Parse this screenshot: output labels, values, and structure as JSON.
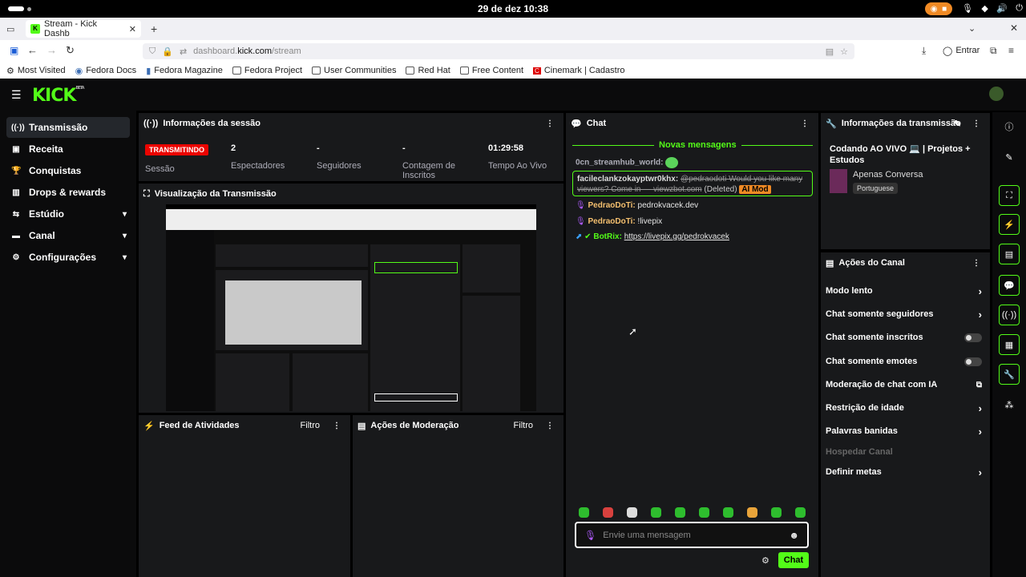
{
  "os": {
    "clock": "29 de dez  10:38"
  },
  "browser": {
    "tab_title": "Stream - Kick Dashb",
    "url_prefix": "dashboard.",
    "url_host": "kick.com",
    "url_path": "/stream",
    "signin": "Entrar",
    "bookmarks": [
      "Most Visited",
      "Fedora Docs",
      "Fedora Magazine",
      "Fedora Project",
      "User Communities",
      "Red Hat",
      "Free Content",
      "Cinemark | Cadastro"
    ]
  },
  "brand": {
    "logo": "KICK",
    "beta": "BETA",
    "accent": "#53fc18"
  },
  "sidebar": {
    "items": [
      {
        "label": "Transmissão",
        "icon": "broadcast-icon"
      },
      {
        "label": "Receita",
        "icon": "revenue-icon"
      },
      {
        "label": "Conquistas",
        "icon": "trophy-icon"
      },
      {
        "label": "Drops & rewards",
        "icon": "drops-icon"
      },
      {
        "label": "Estúdio",
        "icon": "studio-icon"
      },
      {
        "label": "Canal",
        "icon": "channel-icon"
      },
      {
        "label": "Configurações",
        "icon": "gear-icon"
      }
    ]
  },
  "session": {
    "title": "Informações da sessão",
    "status": "TRANSMITINDO",
    "stats": [
      {
        "value": "2",
        "label": "Espectadores"
      },
      {
        "value": "-",
        "label": "Seguidores"
      },
      {
        "value": "-",
        "label": "Contagem de Inscritos"
      },
      {
        "value": "01:29:58",
        "label": "Tempo Ao Vivo"
      }
    ],
    "session_label": "Sessão"
  },
  "preview": {
    "title": "Visualização da Transmissão"
  },
  "feed": {
    "title": "Feed de Atividades",
    "filter": "Filtro"
  },
  "moderation": {
    "title": "Ações de Moderação",
    "filter": "Filtro"
  },
  "chat": {
    "title": "Chat",
    "new_messages": "Novas mensagens",
    "messages": [
      {
        "user": "0cn_streamhub_world:",
        "text": ""
      },
      {
        "user": "facileclankzokayptwr0khx:",
        "text": "@pedraodoti Would you like many viewers? Come in — viewzbot.com",
        "deleted": "(Deleted)",
        "tag": "AI Mod"
      },
      {
        "user": "PedraoDoTi:",
        "text": "pedrokvacek.dev"
      },
      {
        "user": "PedraoDoTi:",
        "text": "!livepix"
      },
      {
        "user": "BotRix:",
        "text": "https://livepix.gg/pedrokvacek"
      }
    ],
    "placeholder": "Envie uma mensagem",
    "send": "Chat"
  },
  "stream_info": {
    "title": "Informações da transmissão",
    "stream_title": "Codando AO VIVO 💻 | Projetos + Estudos",
    "category": "Apenas Conversa",
    "language": "Portuguese"
  },
  "channel_actions": {
    "title": "Ações do Canal",
    "items": [
      {
        "label": "Modo lento",
        "control": "chevron"
      },
      {
        "label": "Chat somente seguidores",
        "control": "chevron"
      },
      {
        "label": "Chat somente inscritos",
        "control": "toggle"
      },
      {
        "label": "Chat somente emotes",
        "control": "toggle"
      },
      {
        "label": "Moderação de chat com IA",
        "control": "external"
      },
      {
        "label": "Restrição de idade",
        "control": "chevron"
      },
      {
        "label": "Palavras banidas",
        "control": "chevron"
      },
      {
        "label": "Hospedar Canal",
        "control": "disabled"
      },
      {
        "label": "Definir metas",
        "control": "chevron"
      }
    ]
  }
}
